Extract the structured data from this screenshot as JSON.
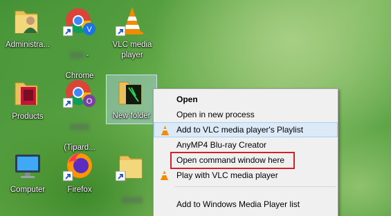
{
  "desktop": {
    "icons": [
      {
        "name": "administrator",
        "label": "Administra..."
      },
      {
        "name": "chrome",
        "label": "Chrome",
        "badge": "V"
      },
      {
        "name": "vlc",
        "label": "VLC media\nplayer"
      },
      {
        "name": "products",
        "label": "Products"
      },
      {
        "name": "chrome-tipard",
        "label": "(Tipard...",
        "badge": "O"
      },
      {
        "name": "new-folder",
        "label": "New folder"
      },
      {
        "name": "computer",
        "label": "Computer"
      },
      {
        "name": "firefox",
        "label": "Firefox"
      }
    ]
  },
  "context_menu": {
    "items": [
      {
        "label": "Open",
        "bold": true
      },
      {
        "label": "Open in new process"
      },
      {
        "label": "Add to VLC media player's Playlist",
        "icon": "vlc-cone-icon"
      },
      {
        "label": "AnyMP4 Blu-ray Creator"
      },
      {
        "label": "Open command window here",
        "highlighted": true
      },
      {
        "label": "Play with VLC media player",
        "icon": "vlc-cone-icon"
      },
      {
        "label": "Add to Windows Media Player list"
      }
    ]
  },
  "colors": {
    "highlight_border": "#d21f2a",
    "menu_background": "#f0f0f0"
  }
}
